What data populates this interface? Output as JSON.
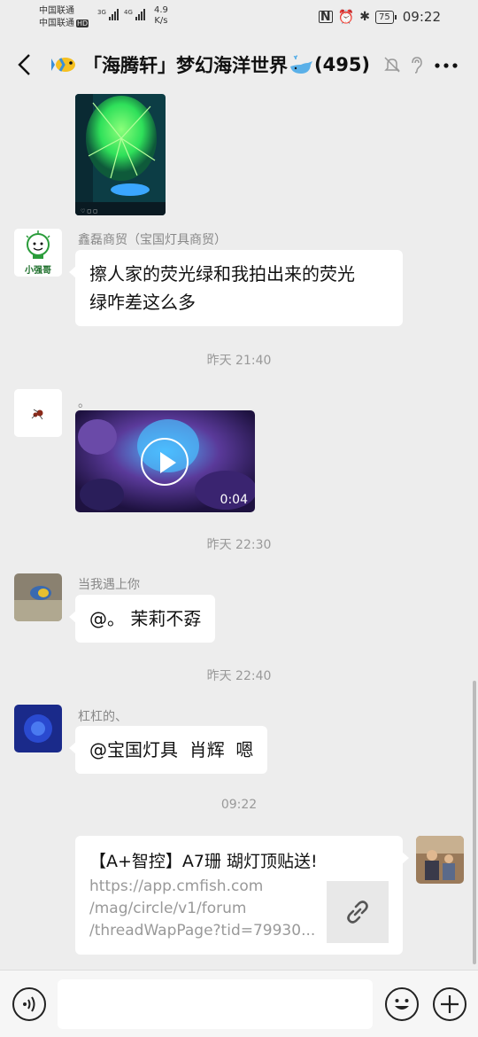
{
  "status": {
    "carrier1": "中国联通",
    "carrier2": "中国联通",
    "hd": "HD",
    "net1": "3G",
    "net2": "4G",
    "speed_value": "4.9",
    "speed_unit": "K/s",
    "battery": "75",
    "time": "09:22"
  },
  "header": {
    "title": "「海腾轩」梦幻海洋世界",
    "count": "(495)"
  },
  "messages": {
    "m1": {
      "sender": "鑫磊商贸（宝国灯具商贸）",
      "text_line1": "擦人家的荧光绿和我拍出来的荧光",
      "text_line2": "绿咋差这么多",
      "avatar_text": "小强哥"
    },
    "ts1": "昨天 21:40",
    "m2": {
      "sender": "。",
      "duration": "0:04"
    },
    "ts2": "昨天 22:30",
    "m3": {
      "sender": "当我遇上你",
      "text": "@。 茉莉不孬"
    },
    "ts3": "昨天 22:40",
    "m4": {
      "sender": "杠杠的、",
      "text": "@宝国灯具  肖辉  嗯"
    },
    "ts4": "09:22",
    "m5": {
      "title": "【A+智控】A7珊 瑚灯顶贴送!",
      "url1": "https://app.cmfish.com",
      "url2": "/mag/circle/v1/forum",
      "url3": "/threadWapPage?tid=79930..."
    }
  },
  "input": {
    "value": ""
  },
  "colors": {
    "background": "#ededed",
    "bubble": "#ffffff",
    "meta": "#999999",
    "coral_green": "#2fe05a",
    "video_purple": "#5a3a9a"
  }
}
